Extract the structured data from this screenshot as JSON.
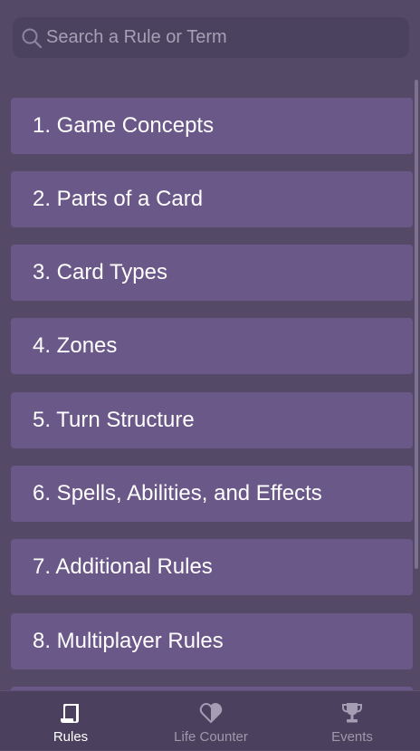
{
  "search": {
    "placeholder": "Search a Rule or Term",
    "value": ""
  },
  "rules": [
    {
      "label": "1. Game Concepts"
    },
    {
      "label": "2. Parts of a Card"
    },
    {
      "label": "3. Card Types"
    },
    {
      "label": "4. Zones"
    },
    {
      "label": "5. Turn Structure"
    },
    {
      "label": "6. Spells, Abilities, and Effects"
    },
    {
      "label": "7. Additional Rules"
    },
    {
      "label": "8. Multiplayer Rules"
    }
  ],
  "bottom_nav": {
    "active": "Rules",
    "items": [
      {
        "label": "Rules",
        "icon": "scroll-icon"
      },
      {
        "label": "Life Counter",
        "icon": "heart-icon"
      },
      {
        "label": "Events",
        "icon": "trophy-icon"
      }
    ]
  },
  "colors": {
    "background": "#544a67",
    "search_background": "#4b4260",
    "rule_item": "#6a5889",
    "nav_background": "#4b415e",
    "nav_inactive": "#9f98ac",
    "nav_active": "#ffffff"
  }
}
